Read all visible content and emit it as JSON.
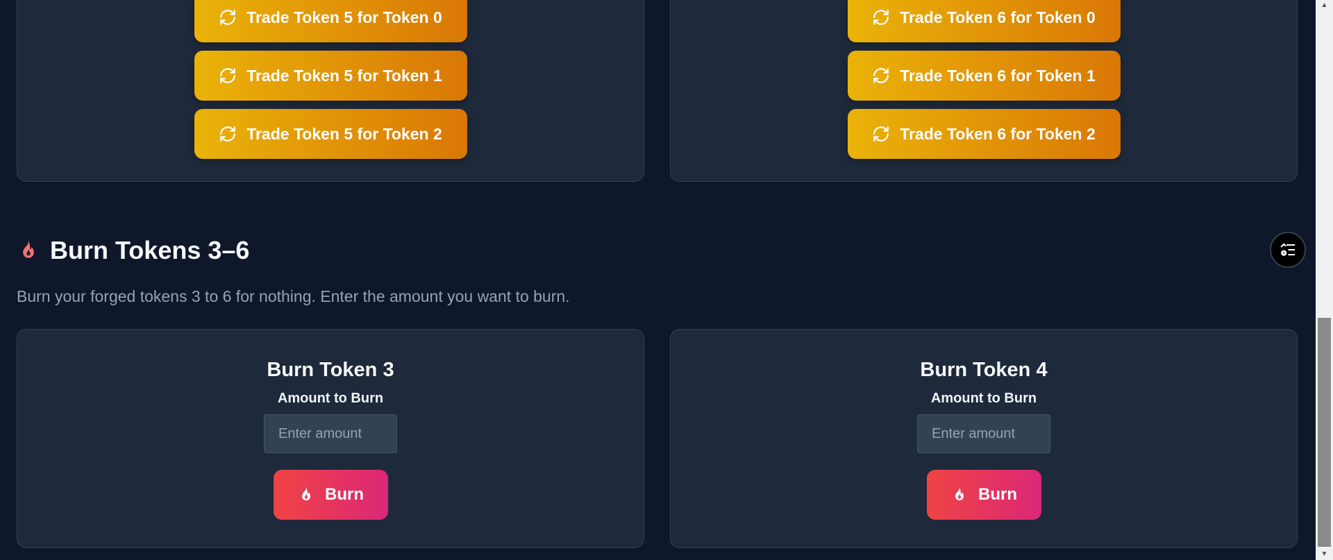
{
  "trade_cards": [
    {
      "buttons": [
        "Trade Token 5 for Token 0",
        "Trade Token 5 for Token 1",
        "Trade Token 5 for Token 2"
      ]
    },
    {
      "buttons": [
        "Trade Token 6 for Token 0",
        "Trade Token 6 for Token 1",
        "Trade Token 6 for Token 2"
      ]
    }
  ],
  "burn_section": {
    "title": "Burn Tokens 3–6",
    "description": "Burn your forged tokens 3 to 6 for nothing. Enter the amount you want to burn.",
    "cards": [
      {
        "title": "Burn Token 3",
        "amount_label": "Amount to Burn",
        "placeholder": "Enter amount",
        "button_label": "Burn"
      },
      {
        "title": "Burn Token 4",
        "amount_label": "Amount to Burn",
        "placeholder": "Enter amount",
        "button_label": "Burn"
      }
    ]
  },
  "icons": {
    "trade": "refresh-icon",
    "burn": "flame-icon",
    "fab": "list-settings-icon"
  },
  "colors": {
    "background": "#0f172a",
    "card": "#1e293b",
    "trade_gradient": [
      "#eab308",
      "#d97706"
    ],
    "burn_gradient": [
      "#ef4444",
      "#db2777"
    ],
    "flame_accent": "#f87171"
  }
}
